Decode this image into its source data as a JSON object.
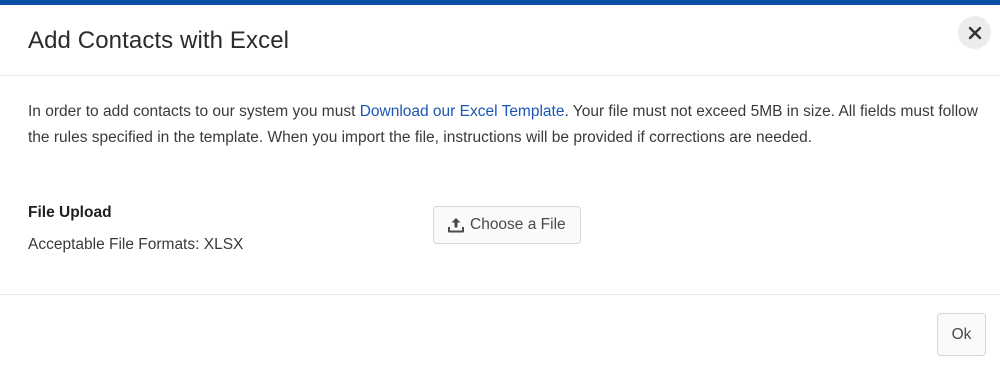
{
  "header": {
    "title": "Add Contacts with Excel",
    "close_icon": "close-icon"
  },
  "body": {
    "intro_before_link": "In order to add contacts to our system you must ",
    "intro_link": "Download our Excel Template",
    "intro_after_link": ". Your file must not exceed 5MB in size. All fields must follow the rules specified in the template. When you import the file, instructions will be provided if corrections are needed.",
    "upload_label": "File Upload",
    "formats_label": "Acceptable File Formats: XLSX",
    "choose_file_label": "Choose a File",
    "upload_icon": "upload-icon"
  },
  "footer": {
    "ok_label": "Ok"
  },
  "colors": {
    "accent_bar": "#0a4ea8",
    "link": "#1a56b5"
  }
}
